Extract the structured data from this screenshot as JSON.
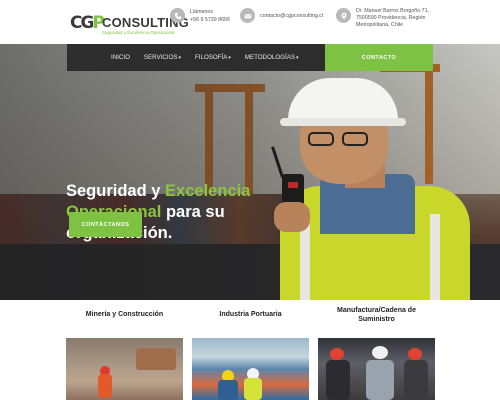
{
  "header": {
    "logo": {
      "mark_left": "CG",
      "mark_right": "P",
      "word": "CONSULTING",
      "tagline": "Seguridad y Excelencia Operacional"
    },
    "phone": {
      "label": "Llámenos",
      "value": "+56 9 5739 8606"
    },
    "email": {
      "value": "contacto@cgpconsulting.cl"
    },
    "address": {
      "line1": "Dr. Manuel Barros Borgoño 71,",
      "line2": "7500590 Providencia, Región",
      "line3": "Metropolitana, Chile"
    }
  },
  "nav": {
    "items": [
      {
        "label": "INICIO",
        "dropdown": false
      },
      {
        "label": "SERVICIOS",
        "dropdown": true
      },
      {
        "label": "FILOSOFÍA",
        "dropdown": true
      },
      {
        "label": "METODOLOGÍAS",
        "dropdown": true
      }
    ],
    "chevron": "▾",
    "contact_label": "CONTACTO"
  },
  "hero": {
    "title_part1": "Seguridad y ",
    "title_highlight": "Excelencia Operacional",
    "title_part2": " para su organización.",
    "cta_label": "CONTÁCTANOS"
  },
  "cards": [
    {
      "title": "Minería y Construcción"
    },
    {
      "title": "Industria Portuaria"
    },
    {
      "title": "Manufactura/Cadena de Suministro"
    }
  ],
  "colors": {
    "accent": "#7dc242",
    "nav_bg": "#2d2d2d",
    "vest": "#c9d72b"
  }
}
